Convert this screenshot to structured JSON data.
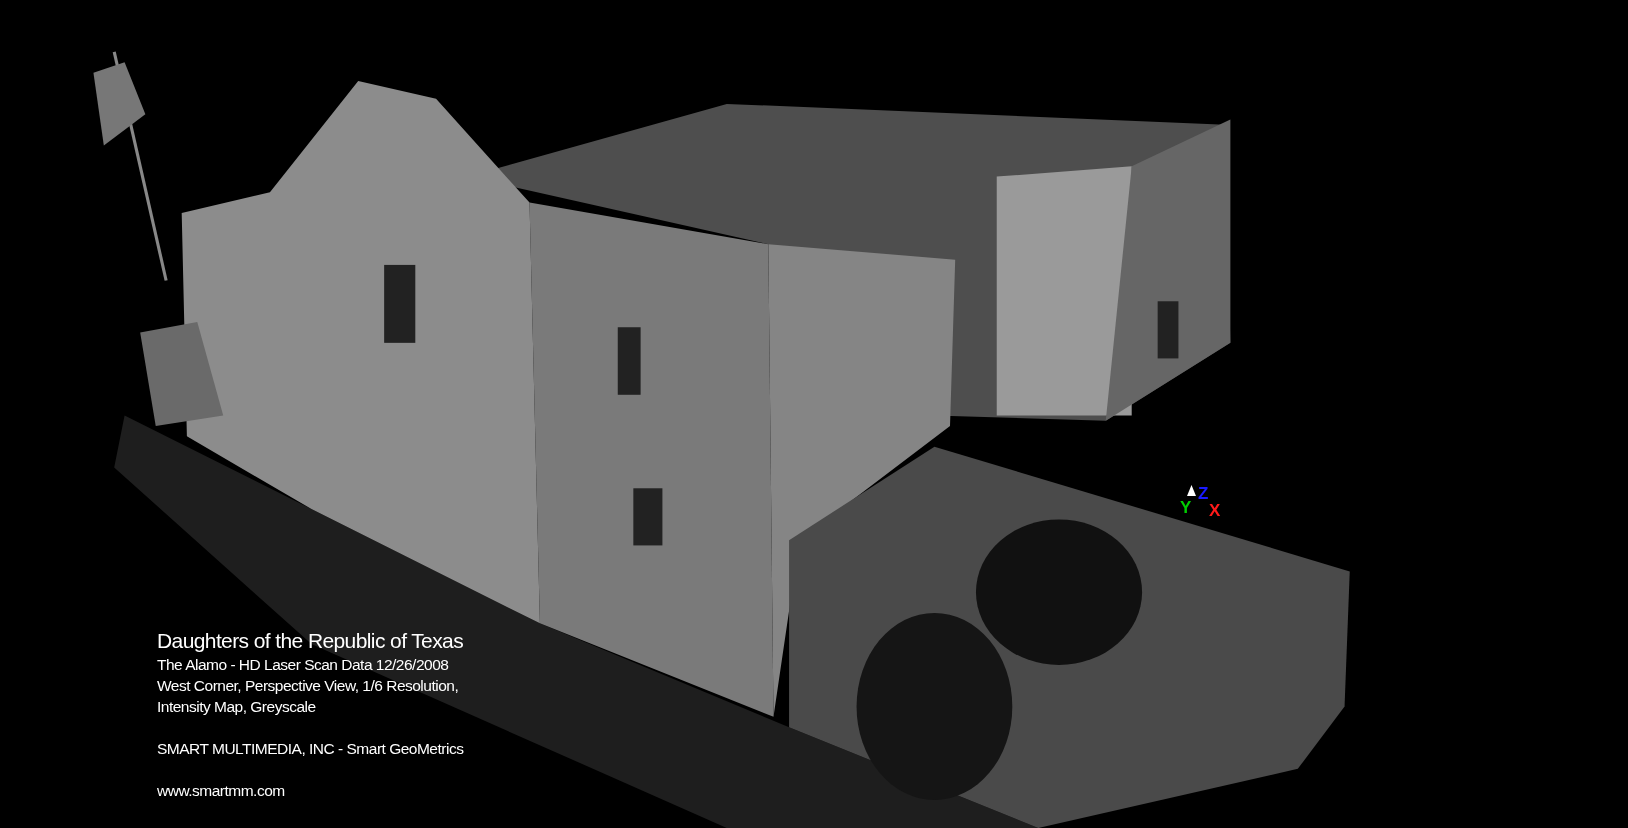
{
  "caption": {
    "title": "Daughters of the Republic of Texas",
    "lines": [
      "The Alamo - HD Laser Scan Data 12/26/2008",
      "West Corner, Perspective View, 1/6 Resolution,",
      "Intensity Map, Greyscale"
    ],
    "company": "SMART MULTIMEDIA, INC - Smart GeoMetrics",
    "website": "www.smartmm.com"
  },
  "axis_triad": {
    "labels": [
      {
        "kind": "vertical",
        "text": "Z",
        "color": "#1a1aff"
      },
      {
        "kind": "left",
        "text": "Y",
        "color": "#00cc00"
      },
      {
        "kind": "right",
        "text": "X",
        "color": "#ff1a1a"
      }
    ]
  }
}
